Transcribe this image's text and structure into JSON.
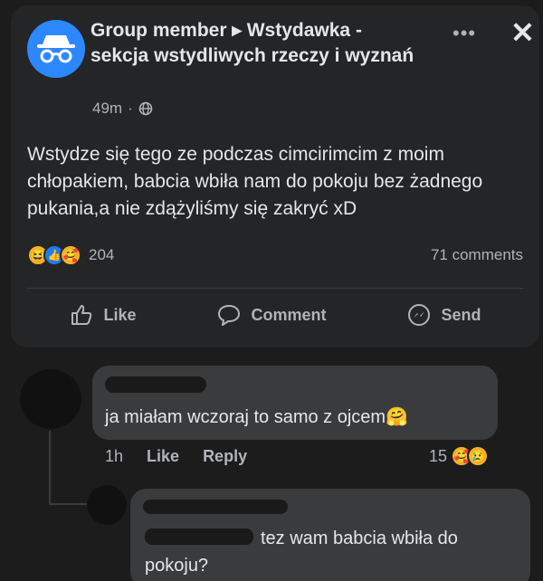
{
  "post": {
    "header_text": "Group member ▸ Wstydawka - sekcja wstydliwych rzeczy i wyznań",
    "time": "49m",
    "privacy_icon": "globe-icon",
    "body": "Wstydze się tego ze podczas cimcirimcim z moim chłopakiem, babcia wbiła nam do pokoju bez żadnego pukania,a nie zdążyliśmy się zakryć xD",
    "reaction_count": "204",
    "comments_count": "71 comments",
    "actions": {
      "like": "Like",
      "comment": "Comment",
      "send": "Send"
    }
  },
  "comments": [
    {
      "text": "ja miałam wczoraj to samo z ojcem🤗",
      "time": "1h",
      "like": "Like",
      "reply": "Reply",
      "reaction_count": "15"
    },
    {
      "text": "tez wam babcia wbiła do pokoju?"
    }
  ],
  "colors": {
    "background": "#1c1c1d",
    "card": "#242526",
    "bubble": "#3a3b3c",
    "accent": "#2d88ff"
  }
}
